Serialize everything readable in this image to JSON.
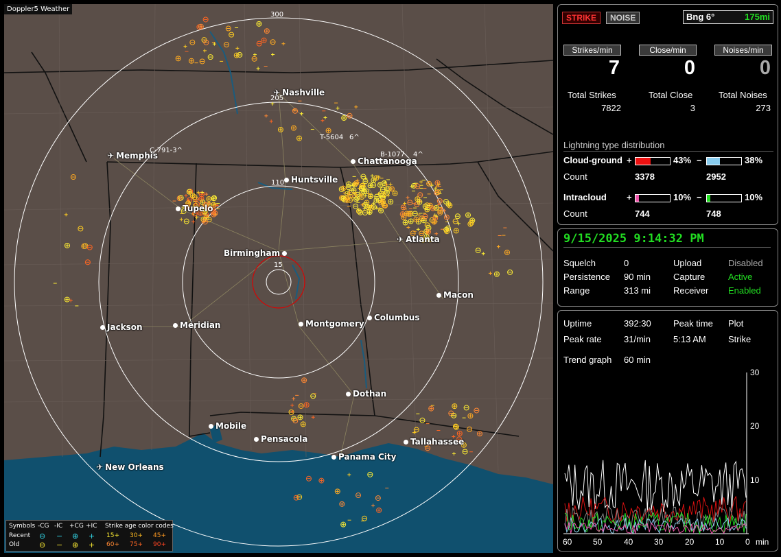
{
  "brand": "Doppler5 Weather",
  "map": {
    "ring_labels": [
      "300",
      "205",
      "110",
      "15"
    ],
    "cities": [
      {
        "name": "Nashville",
        "airport": true
      },
      {
        "name": "Memphis",
        "airport": true
      },
      {
        "name": "Chattanooga",
        "airport": false
      },
      {
        "name": "Huntsville",
        "airport": false
      },
      {
        "name": "Tupelo",
        "airport": false
      },
      {
        "name": "Atlanta",
        "airport": true
      },
      {
        "name": "Birmingham",
        "airport": false
      },
      {
        "name": "Macon",
        "airport": false
      },
      {
        "name": "Jackson",
        "airport": false
      },
      {
        "name": "Meridian",
        "airport": false
      },
      {
        "name": "Montgomery",
        "airport": false
      },
      {
        "name": "Columbus",
        "airport": false
      },
      {
        "name": "Dothan",
        "airport": false
      },
      {
        "name": "Mobile",
        "airport": false
      },
      {
        "name": "Pensacola",
        "airport": false
      },
      {
        "name": "Tallahassee",
        "airport": false
      },
      {
        "name": "Panama City",
        "airport": false
      },
      {
        "name": "New Orleans",
        "airport": true
      }
    ],
    "tracks": [
      "C-791-3^",
      "T-5604",
      "6^",
      "B-1077",
      "4^"
    ]
  },
  "legend": {
    "symbols_label": "Symbols",
    "col_neg_cg": "-CG",
    "col_neg_ic": "-IC",
    "col_pos_cg": "+CG",
    "col_pos_ic": "+IC",
    "age_title": "Strike age color codes",
    "recent_label": "Recent",
    "old_label": "Old",
    "recent_ages": [
      "15+",
      "30+",
      "45+"
    ],
    "old_ages": [
      "60+",
      "75+",
      "90+"
    ],
    "glyph_neg_cg": "⊖",
    "glyph_neg_ic": "−",
    "glyph_pos_cg": "⊕",
    "glyph_pos_ic": "+"
  },
  "top_panel": {
    "strike_btn": "STRIKE",
    "noise_btn": "NOISE",
    "bearing": "Bng 6°",
    "range": "175mi",
    "rate_headers": [
      "Strikes/min",
      "Close/min",
      "Noises/min"
    ],
    "rate_values": [
      "7",
      "0",
      "0"
    ],
    "total_labels": [
      "Total Strikes",
      "Total Close",
      "Total Noises"
    ],
    "total_values": [
      "7822",
      "3",
      "273"
    ],
    "dist_title": "Lightning type distribution",
    "cg_label": "Cloud-ground",
    "ic_label": "Intracloud",
    "count_label": "Count",
    "plus": "+",
    "minus": "−",
    "cg_pos_pct": "43%",
    "cg_neg_pct": "38%",
    "cg_pos_count": "3378",
    "cg_neg_count": "2952",
    "ic_pos_pct": "10%",
    "ic_neg_pct": "10%",
    "ic_pos_count": "744",
    "ic_neg_count": "748",
    "cg_pos_fill": 0.43,
    "cg_neg_fill": 0.38,
    "ic_pos_fill": 0.1,
    "ic_neg_fill": 0.1
  },
  "status_panel": {
    "datetime": "9/15/2025 9:14:32 PM",
    "squelch_label": "Squelch",
    "squelch": "0",
    "persistence_label": "Persistence",
    "persistence": "90 min",
    "range_label": "Range",
    "range": "313 mi",
    "upload_label": "Upload",
    "upload": "Disabled",
    "capture_label": "Capture",
    "capture": "Active",
    "receiver_label": "Receiver",
    "receiver": "Enabled"
  },
  "trend_panel": {
    "uptime_label": "Uptime",
    "uptime": "392:30",
    "peak_time_label": "Peak time",
    "peak_time": "5:13 AM",
    "plot_label": "Plot",
    "plot": "Strike",
    "peak_rate_label": "Peak rate",
    "peak_rate": "31/min",
    "trend_label": "Trend graph",
    "trend": "60 min",
    "y_ticks": [
      "30",
      "20",
      "10"
    ],
    "x_ticks": [
      "60",
      "50",
      "40",
      "30",
      "20",
      "10",
      "0"
    ],
    "x_unit": "min"
  },
  "colors": {
    "map_bg": "#5a4e48",
    "water": "#10506e",
    "green": "#22dd22",
    "strike_red": "#cc0000"
  }
}
